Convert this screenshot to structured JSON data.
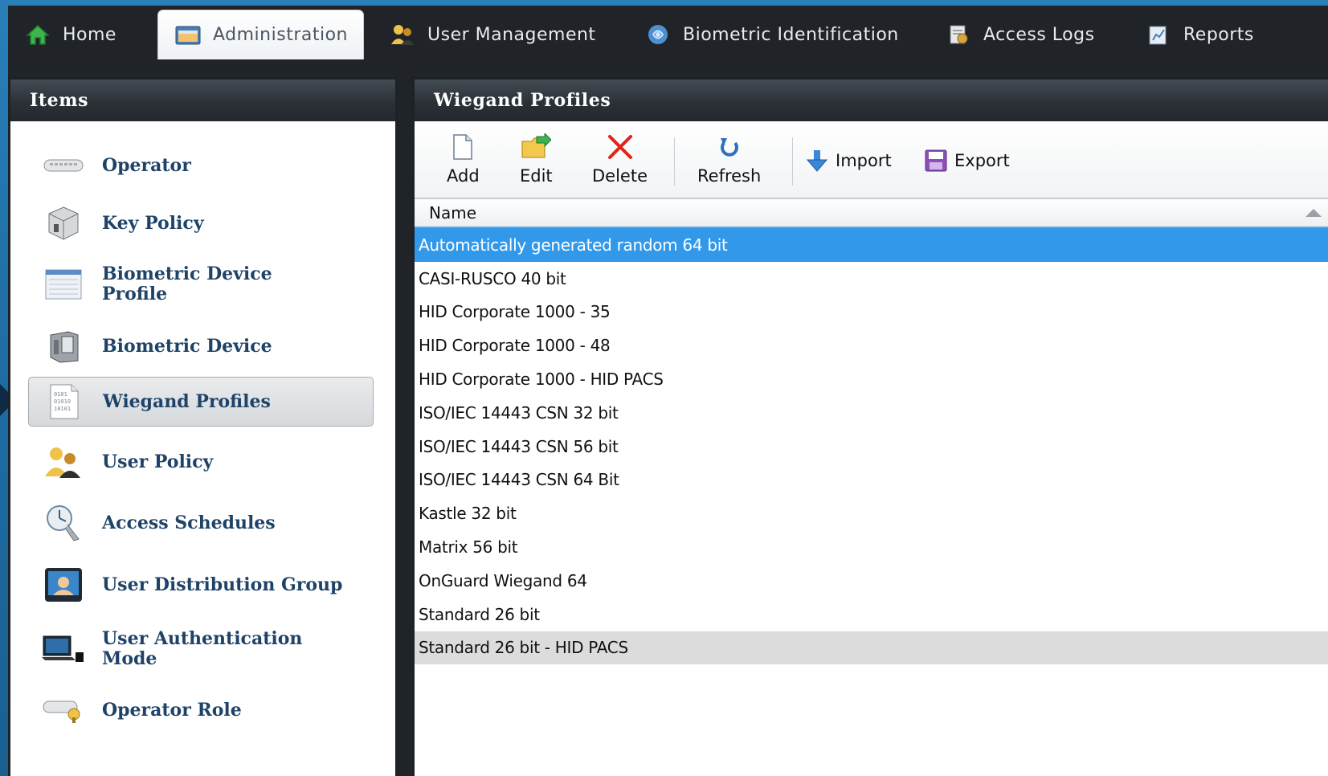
{
  "tabs": [
    {
      "label": "Home",
      "icon": "home-icon"
    },
    {
      "label": "Administration",
      "icon": "administration-icon",
      "active": true
    },
    {
      "label": "User Management",
      "icon": "user-management-icon"
    },
    {
      "label": "Biometric Identification",
      "icon": "biometric-identification-icon"
    },
    {
      "label": "Access Logs",
      "icon": "access-logs-icon"
    },
    {
      "label": "Reports",
      "icon": "reports-icon"
    }
  ],
  "sidebar": {
    "title": "Items",
    "items": [
      {
        "label": "Operator",
        "icon": "keyboard-icon"
      },
      {
        "label": "Key Policy",
        "icon": "key-box-icon"
      },
      {
        "label": "Biometric Device Profile",
        "icon": "device-profile-icon"
      },
      {
        "label": "Biometric Device",
        "icon": "biometric-device-icon"
      },
      {
        "label": "Wiegand Profiles",
        "icon": "binary-document-icon",
        "selected": true
      },
      {
        "label": "User Policy",
        "icon": "users-icon"
      },
      {
        "label": "Access Schedules",
        "icon": "schedule-icon"
      },
      {
        "label": "User Distribution Group",
        "icon": "distribution-group-icon"
      },
      {
        "label": "User Authentication Mode",
        "icon": "authentication-mode-icon"
      },
      {
        "label": "Operator Role",
        "icon": "operator-role-icon"
      }
    ]
  },
  "main": {
    "title": "Wiegand Profiles",
    "toolbar": {
      "add": "Add",
      "edit": "Edit",
      "delete": "Delete",
      "refresh": "Refresh",
      "import": "Import",
      "export": "Export"
    },
    "column_name": "Name",
    "rows": [
      "Automatically generated random 64 bit",
      "CASI-RUSCO 40 bit",
      "HID Corporate 1000 - 35",
      "HID Corporate 1000 - 48",
      "HID Corporate 1000 - HID PACS",
      "ISO/IEC 14443 CSN 32 bit",
      "ISO/IEC 14443 CSN 56 bit",
      "ISO/IEC 14443 CSN 64 Bit",
      "Kastle 32 bit",
      "Matrix 56 bit",
      "OnGuard Wiegand 64",
      "Standard 26 bit",
      "Standard 26 bit - HID PACS"
    ],
    "selected_row": "Automatically generated random 64 bit",
    "highlighted_row": "Standard 26 bit - HID PACS"
  },
  "colors": {
    "selection": "#3299ea",
    "nav_text": "#1f4368",
    "background_blue": "#1f6fa6",
    "dark_chrome": "#202428"
  }
}
